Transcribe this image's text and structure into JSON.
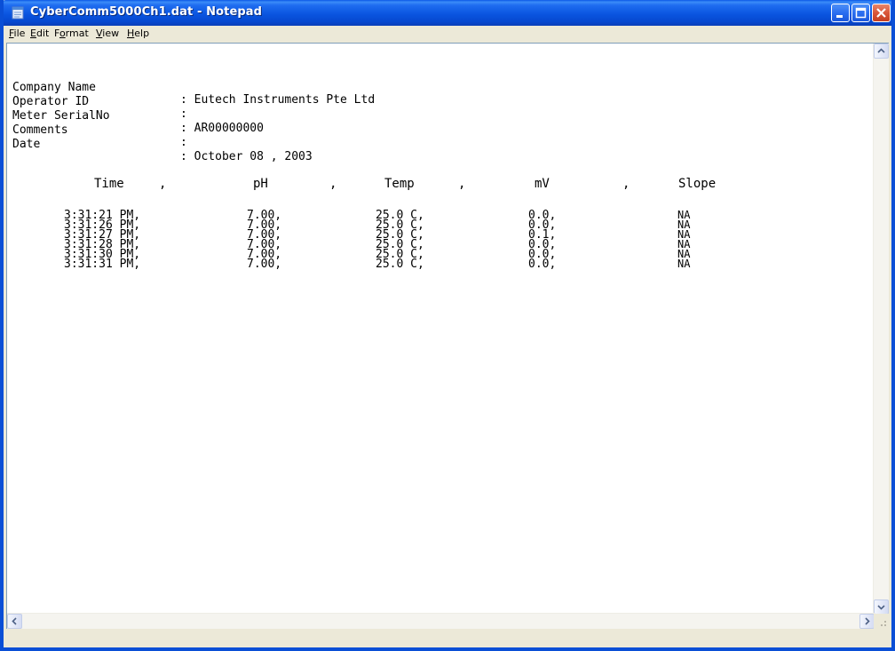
{
  "window": {
    "title": "CyberComm5000Ch1.dat - Notepad",
    "icon": "notepad-icon",
    "accent": "#0a55e0"
  },
  "menu": [
    {
      "label": "File",
      "accel": "F",
      "rest": "ile"
    },
    {
      "label": "Edit",
      "accel": "E",
      "rest": "dit"
    },
    {
      "label": "Format",
      "accel": "o",
      "pre": "F",
      "rest": "rmat"
    },
    {
      "label": "View",
      "accel": "V",
      "rest": "iew"
    },
    {
      "label": "Help",
      "accel": "H",
      "rest": "elp"
    }
  ],
  "document": {
    "header": [
      {
        "label": "Company Name",
        "value": ": Eutech Instruments Pte Ltd"
      },
      {
        "label": "Operator ID",
        "value": ":"
      },
      {
        "label": "Meter SerialNo",
        "value": ": AR00000000"
      },
      {
        "label": "Comments",
        "value": ":"
      },
      {
        "label": "Date",
        "value": ": October 08 , 2003"
      }
    ],
    "columns": [
      "Time",
      ",",
      "pH",
      ",",
      "Temp",
      ",",
      "mV",
      ",",
      "Slope"
    ],
    "rows": [
      {
        "time": "3:31:21 PM,",
        "ph": "7.00,",
        "temp": "25.0  C,",
        "mv": "0.0,",
        "slope": "NA"
      },
      {
        "time": "3:31:26 PM,",
        "ph": "7.00,",
        "temp": "25.0  C,",
        "mv": "0.0,",
        "slope": "NA"
      },
      {
        "time": "3:31:27 PM,",
        "ph": "7.00,",
        "temp": "25.0  C,",
        "mv": "0.1,",
        "slope": "NA"
      },
      {
        "time": "3:31:28 PM,",
        "ph": "7.00,",
        "temp": "25.0  C,",
        "mv": "0.0,",
        "slope": "NA"
      },
      {
        "time": "3:31:30 PM,",
        "ph": "7.00,",
        "temp": "25.0  C,",
        "mv": "0.0,",
        "slope": "NA"
      },
      {
        "time": "3:31:31 PM,",
        "ph": "7.00,",
        "temp": "25.0  C,",
        "mv": "0.0,",
        "slope": "NA"
      }
    ]
  }
}
